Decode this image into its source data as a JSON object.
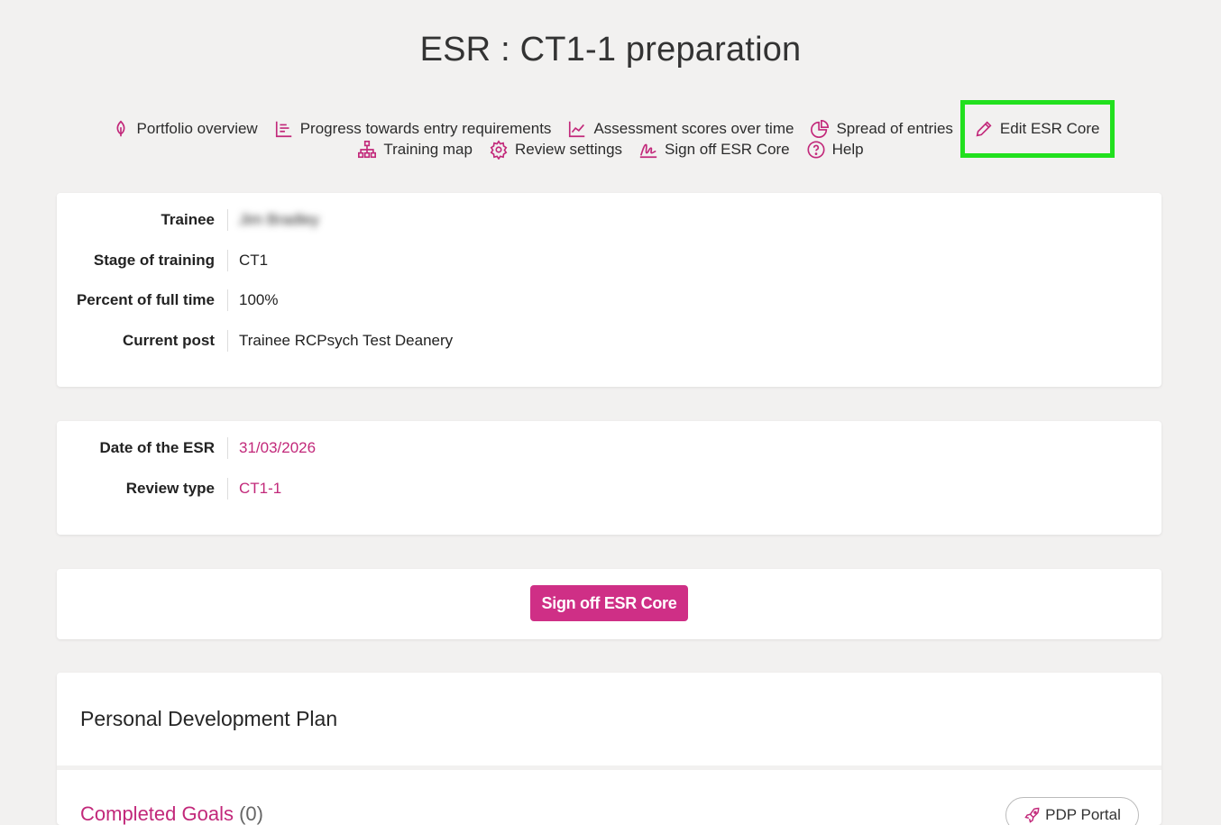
{
  "page": {
    "title": "ESR : CT1-1 preparation"
  },
  "nav": {
    "row1": [
      {
        "label": "Portfolio overview",
        "icon": "leaf-icon"
      },
      {
        "label": "Progress towards entry requirements",
        "icon": "list-chart-icon"
      },
      {
        "label": "Assessment scores over time",
        "icon": "line-chart-icon"
      },
      {
        "label": "Spread of entries",
        "icon": "pie-chart-icon"
      },
      {
        "label": "Edit ESR Core",
        "icon": "pencil-icon"
      }
    ],
    "row2": [
      {
        "label": "Training map",
        "icon": "sitemap-icon"
      },
      {
        "label": "Review settings",
        "icon": "gear-icon"
      },
      {
        "label": "Sign off ESR Core",
        "icon": "signature-icon"
      },
      {
        "label": "Help",
        "icon": "question-icon"
      }
    ]
  },
  "trainee_card": {
    "trainee_label": "Trainee",
    "trainee_value": "Jim Bradley",
    "stage_label": "Stage of training",
    "stage_value": "CT1",
    "percent_label": "Percent of full time",
    "percent_value": "100%",
    "post_label": "Current post",
    "post_value": "Trainee RCPsych Test Deanery"
  },
  "esr_card": {
    "date_label": "Date of the ESR",
    "date_value": "31/03/2026",
    "type_label": "Review type",
    "type_value": "CT1-1"
  },
  "signoff": {
    "button_label": "Sign off ESR Core"
  },
  "pdp": {
    "title": "Personal Development Plan",
    "completed_label": "Completed Goals",
    "completed_count": "(0)",
    "portal_label": "PDP Portal"
  },
  "colors": {
    "accent": "#c2287a",
    "button": "#cf2f86",
    "highlight": "#22e01e",
    "background": "#f2f1f0"
  }
}
